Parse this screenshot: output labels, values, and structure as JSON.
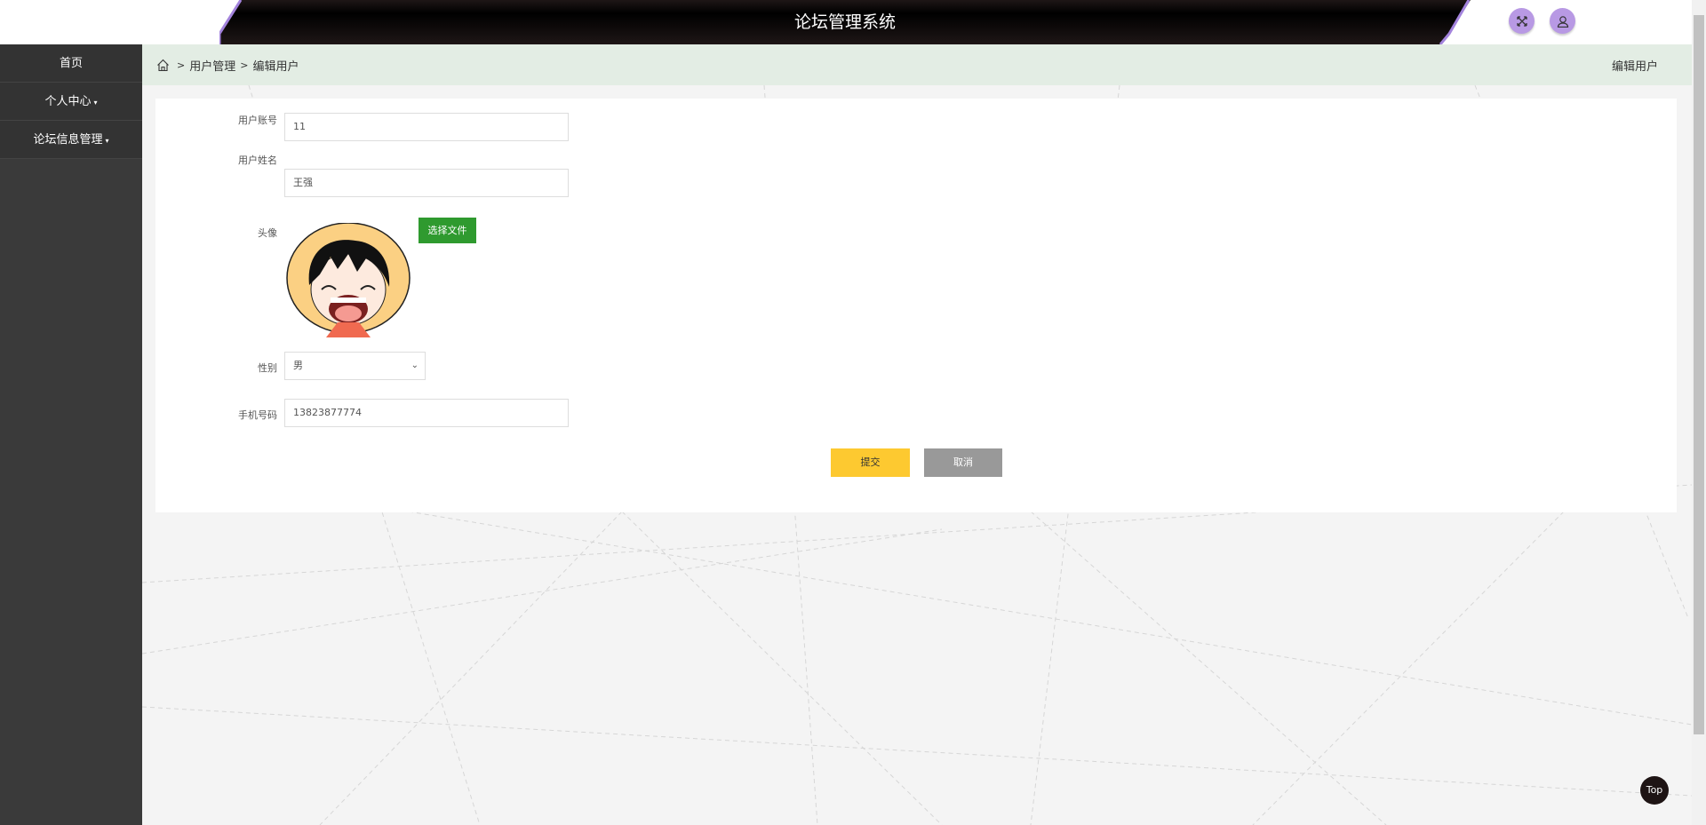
{
  "header": {
    "title": "论坛管理系统",
    "icons": [
      "fullscreen-icon",
      "user-icon"
    ]
  },
  "sidebar": {
    "items": [
      {
        "label": "首页"
      },
      {
        "label": "个人中心",
        "caret": "▾"
      },
      {
        "label": "论坛信息管理",
        "caret": "▾"
      }
    ]
  },
  "breadcrumb": {
    "sep": ">",
    "items": [
      "用户管理",
      "编辑用户"
    ],
    "current": "编辑用户"
  },
  "form": {
    "account": {
      "label": "用户账号",
      "value": "11"
    },
    "name": {
      "label": "用户姓名",
      "value": "王强"
    },
    "avatar": {
      "label": "头像",
      "button": "选择文件"
    },
    "gender": {
      "label": "性别",
      "value": "男"
    },
    "phone": {
      "label": "手机号码",
      "value": "13823877774"
    },
    "submit": "提交",
    "cancel": "取消"
  },
  "colors": {
    "accent": "#b899e4",
    "submit": "#fdc930",
    "cancel": "#999999",
    "file": "#2f9a2f",
    "breadcrumb_bg": "#e3ede4"
  },
  "top_button": "Top"
}
